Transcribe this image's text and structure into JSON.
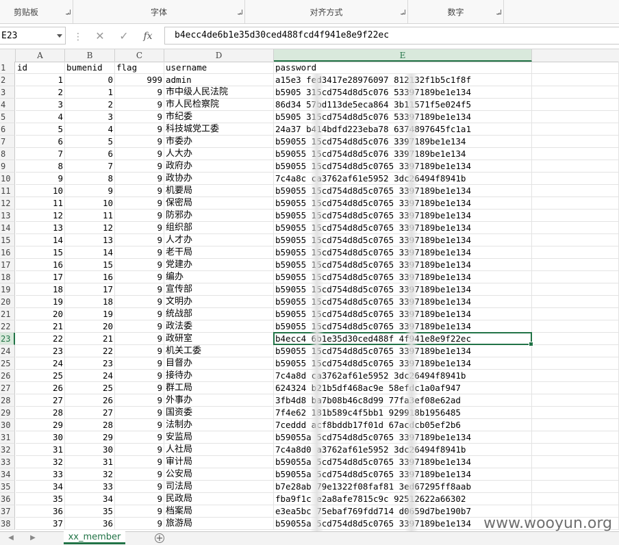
{
  "ribbon": {
    "groups": [
      "剪贴板",
      "字体",
      "对齐方式",
      "数字"
    ]
  },
  "formula_bar": {
    "name_box": "E23",
    "cancel_icon": "close-icon",
    "enter_icon": "check-icon",
    "fx_label": "fx",
    "value": "b4ecc4de6b1e35d30ced488fcd4f941e8e9f22ec"
  },
  "columns": [
    "A",
    "B",
    "C",
    "D",
    "E"
  ],
  "active_cell": {
    "column": "E",
    "row": "23"
  },
  "rows": [
    {
      "n": "1",
      "a": "id",
      "b": "bumenid",
      "c": "flag",
      "d": "username",
      "e": "password"
    },
    {
      "n": "2",
      "a": "1",
      "b": "0",
      "c": "999",
      "d": "admin",
      "e": "a15e3  fed3417e28976097  812132f1b5c1f8f"
    },
    {
      "n": "3",
      "a": "2",
      "b": "1",
      "c": "9",
      "d": "市中级人民法院",
      "e": "b5905  315cd754d8d5c076  53397189be1e134"
    },
    {
      "n": "4",
      "a": "3",
      "b": "2",
      "c": "9",
      "d": "市人民检察院",
      "e": "86d34  57bd113de5eca864  3b11571f5e024f5"
    },
    {
      "n": "5",
      "a": "4",
      "b": "3",
      "c": "9",
      "d": "市纪委",
      "e": "b5905  315cd754d8d5c076  53397189be1e134"
    },
    {
      "n": "6",
      "a": "5",
      "b": "4",
      "c": "9",
      "d": "科技城党工委",
      "e": "24a37  b414bdfd223eba78  6374897645fc1a1"
    },
    {
      "n": "7",
      "a": "6",
      "b": "5",
      "c": "9",
      "d": "市委办",
      "e": "b59055  15cd754d8d5c076  3397189be1e134"
    },
    {
      "n": "8",
      "a": "7",
      "b": "6",
      "c": "9",
      "d": "人大办",
      "e": "b59055  15cd754d8d5c076  3397189be1e134"
    },
    {
      "n": "9",
      "a": "8",
      "b": "7",
      "c": "9",
      "d": "政府办",
      "e": "b59055  15cd754d8d5c0765  3397189be1e134"
    },
    {
      "n": "10",
      "a": "9",
      "b": "8",
      "c": "9",
      "d": "政协办",
      "e": "7c4a8c  ca3762af61e5952  3dc26494f8941b"
    },
    {
      "n": "11",
      "a": "10",
      "b": "9",
      "c": "9",
      "d": "机要局",
      "e": "b59055  15cd754d8d5c0765  3397189be1e134"
    },
    {
      "n": "12",
      "a": "11",
      "b": "10",
      "c": "9",
      "d": "保密局",
      "e": "b59055  15cd754d8d5c0765  3397189be1e134"
    },
    {
      "n": "13",
      "a": "12",
      "b": "11",
      "c": "9",
      "d": "防邪办",
      "e": "b59055  15cd754d8d5c0765  3397189be1e134"
    },
    {
      "n": "14",
      "a": "13",
      "b": "12",
      "c": "9",
      "d": "组织部",
      "e": "b59055  15cd754d8d5c0765  3397189be1e134"
    },
    {
      "n": "15",
      "a": "14",
      "b": "13",
      "c": "9",
      "d": "人才办",
      "e": "b59055  15cd754d8d5c0765  3397189be1e134"
    },
    {
      "n": "16",
      "a": "15",
      "b": "14",
      "c": "9",
      "d": "老干局",
      "e": "b59055  15cd754d8d5c0765  3397189be1e134"
    },
    {
      "n": "17",
      "a": "16",
      "b": "15",
      "c": "9",
      "d": "党建办",
      "e": "b59055  15cd754d8d5c0765  3397189be1e134"
    },
    {
      "n": "18",
      "a": "17",
      "b": "16",
      "c": "9",
      "d": "编办",
      "e": "b59055  15cd754d8d5c0765  3397189be1e134"
    },
    {
      "n": "19",
      "a": "18",
      "b": "17",
      "c": "9",
      "d": "宣传部",
      "e": "b59055  15cd754d8d5c0765  3397189be1e134"
    },
    {
      "n": "20",
      "a": "19",
      "b": "18",
      "c": "9",
      "d": "文明办",
      "e": "b59055  15cd754d8d5c0765  3397189be1e134"
    },
    {
      "n": "21",
      "a": "20",
      "b": "19",
      "c": "9",
      "d": "统战部",
      "e": "b59055  15cd754d8d5c0765  3397189be1e134"
    },
    {
      "n": "22",
      "a": "21",
      "b": "20",
      "c": "9",
      "d": "政法委",
      "e": "b59055  15cd754d8d5c0765  3397189be1e134"
    },
    {
      "n": "23",
      "a": "22",
      "b": "21",
      "c": "9",
      "d": "政研室",
      "e": "b4ecc4  6b1e35d30ced488f  4f941e8e9f22ec"
    },
    {
      "n": "24",
      "a": "23",
      "b": "22",
      "c": "9",
      "d": "机关工委",
      "e": "b59055  15cd754d8d5c0765  3397189be1e134"
    },
    {
      "n": "25",
      "a": "24",
      "b": "23",
      "c": "9",
      "d": "目督办",
      "e": "b59055  15cd754d8d5c0765  3397189be1e134"
    },
    {
      "n": "26",
      "a": "25",
      "b": "24",
      "c": "9",
      "d": "接待办",
      "e": "7c4a8d  ca3762af61e5952  3dc26494f8941b"
    },
    {
      "n": "27",
      "a": "26",
      "b": "25",
      "c": "9",
      "d": "群工局",
      "e": "624324  b21b5df468ac9e  58efdc1a0af947"
    },
    {
      "n": "28",
      "a": "27",
      "b": "26",
      "c": "9",
      "d": "外事办",
      "e": "3fb4d8  ba7b08b46c8d99  77fa3ef08e62ad"
    },
    {
      "n": "29",
      "a": "28",
      "b": "27",
      "c": "9",
      "d": "国资委",
      "e": "7f4e62  181b589c4f5bb1  929918b1956485"
    },
    {
      "n": "30",
      "a": "29",
      "b": "28",
      "c": "9",
      "d": "法制办",
      "e": "7ceddd  acf8bddb17f01d  67acdcb05ef2b6"
    },
    {
      "n": "31",
      "a": "30",
      "b": "29",
      "c": "9",
      "d": "安监局",
      "e": "b59055a  5cd754d8d5c0765  3397189be1e134"
    },
    {
      "n": "32",
      "a": "31",
      "b": "30",
      "c": "9",
      "d": "人社局",
      "e": "7c4a8d0  a3762af61e5952  3dc26494f8941b"
    },
    {
      "n": "33",
      "a": "32",
      "b": "31",
      "c": "9",
      "d": "审计局",
      "e": "b59055a  5cd754d8d5c0765  3397189be1e134"
    },
    {
      "n": "34",
      "a": "33",
      "b": "32",
      "c": "9",
      "d": "公安局",
      "e": "b59055a  5cd754d8d5c0765  3397189be1e134"
    },
    {
      "n": "35",
      "a": "34",
      "b": "33",
      "c": "9",
      "d": "司法局",
      "e": "b7e28ab  79e1322f08faf81  3ed67295ff8aab"
    },
    {
      "n": "36",
      "a": "35",
      "b": "34",
      "c": "9",
      "d": "民政局",
      "e": "fba9f1c  e2a8afe7815c9c  92512622a66302"
    },
    {
      "n": "37",
      "a": "36",
      "b": "35",
      "c": "9",
      "d": "档案局",
      "e": "e3ea5bc  75ebaf769fdd714  d0659d7be190b7"
    },
    {
      "n": "38",
      "a": "37",
      "b": "36",
      "c": "9",
      "d": "旅游局",
      "e": "b59055a  5cd754d8d5c0765  3397189be1e134"
    }
  ],
  "sheet_tabs": {
    "prev_icon": "chevron-left-icon",
    "next_icon": "chevron-right-icon",
    "active": "xx_member",
    "add_icon": "plus-circle-icon"
  },
  "watermark": "www.wooyun.org",
  "colors": {
    "accent": "#217346",
    "header_bg": "#f3f3f3",
    "grid": "#e3e3e3"
  }
}
